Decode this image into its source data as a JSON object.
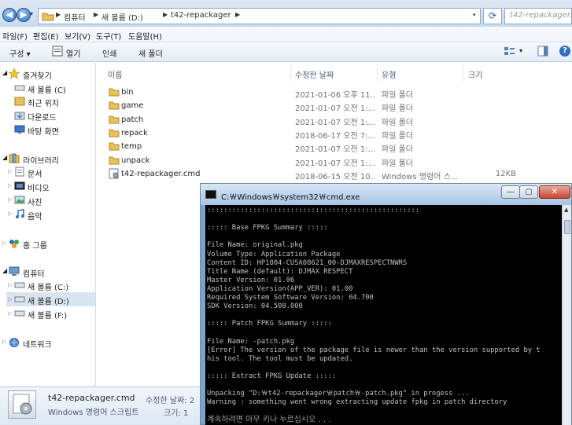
{
  "explorer": {
    "breadcrumb": [
      "컴퓨터",
      "새 볼륨 (D:)",
      "t42-repackager"
    ],
    "search_placeholder": "t42-repackager...",
    "menu": [
      "파일(F)",
      "편집(E)",
      "보기(V)",
      "도구(T)",
      "도움말(H)"
    ],
    "toolbar": {
      "organize": "구성 ▾",
      "open": "열기",
      "print": "인쇄",
      "new_folder": "새 폴더"
    },
    "nav": {
      "favorites": "즐겨찾기",
      "favorites_items": [
        "새 볼륨 (C)",
        "최근 위치",
        "다운로드",
        "바탕 화면"
      ],
      "libraries": "라이브러리",
      "libraries_items": [
        "문서",
        "비디오",
        "사진",
        "음악"
      ],
      "homegroup": "홈 그룹",
      "computer": "컴퓨터",
      "computer_items": [
        "새 볼륨 (C:)",
        "새 볼륨 (D:)",
        "새 볼륨 (F:)"
      ],
      "network": "네트워크"
    },
    "columns": {
      "name": "이름",
      "date": "수정한 날짜",
      "type": "유형",
      "size": "크기"
    },
    "files": [
      {
        "name": "bin",
        "date": "2021-01-06 오후 11...",
        "type": "파일 폴더",
        "size": "",
        "kind": "folder"
      },
      {
        "name": "game",
        "date": "2021-01-07 오전 1:...",
        "type": "파일 폴더",
        "size": "",
        "kind": "folder"
      },
      {
        "name": "patch",
        "date": "2021-01-07 오전 1:...",
        "type": "파일 폴더",
        "size": "",
        "kind": "folder"
      },
      {
        "name": "repack",
        "date": "2018-06-17 오전 7:...",
        "type": "파일 폴더",
        "size": "",
        "kind": "folder"
      },
      {
        "name": "temp",
        "date": "2021-01-07 오전 1:...",
        "type": "파일 폴더",
        "size": "",
        "kind": "folder"
      },
      {
        "name": "unpack",
        "date": "2021-01-07 오전 1:...",
        "type": "파일 폴더",
        "size": "",
        "kind": "folder"
      },
      {
        "name": "t42-repackager.cmd",
        "date": "2018-06-15 오전 10...",
        "type": "Windows 명령어 스...",
        "size": "12KB",
        "kind": "cmd"
      }
    ],
    "details": {
      "name": "t42-repackager.cmd",
      "type": "Windows 명령어 스크립트",
      "modified_label": "수정한 날짜: 2",
      "size_label": "크기: 1"
    }
  },
  "cmd": {
    "title": "C:￦Windows￦system32￦cmd.exe",
    "lines": [
      ":::::::::::::::::::::::::::::::::::::::::::::::::::",
      "",
      "::::: Base FPKG Summary :::::",
      "",
      "File Name: original.pkg",
      "Volume Type: Application Package",
      "Content ID: HP1804-CUSA08621_00-DJMAXRESPECTNWRS",
      "Title Name (default): DJMAX RESPECT",
      "Master Version: 01.06",
      "Application Version(APP_VER): 01.00",
      "Required System Software Version: 04.700",
      "SDK Version: 04.508.000",
      "",
      "::::: Patch FPKG Summary :::::",
      "",
      "File Name: -patch.pkg",
      "[Error] The version of the package file is newer than the version supported by t",
      "his tool. The tool must be updated.",
      "",
      "::::: Extract FPKG Update :::::",
      "",
      "Unpacking \"D:￦t42-repackager￦patch￦-patch.pkg\" in progess ...",
      "Warning : something went wrong extracting update fpkg in patch directory",
      ""
    ],
    "prompt": "계속하려면 아무 키나 누르십시오 . . ."
  },
  "colors": {
    "accent": "#2f6fc0",
    "folder": "#e8c15a",
    "console_bg": "#000000",
    "console_fg": "#c0c0c0"
  }
}
